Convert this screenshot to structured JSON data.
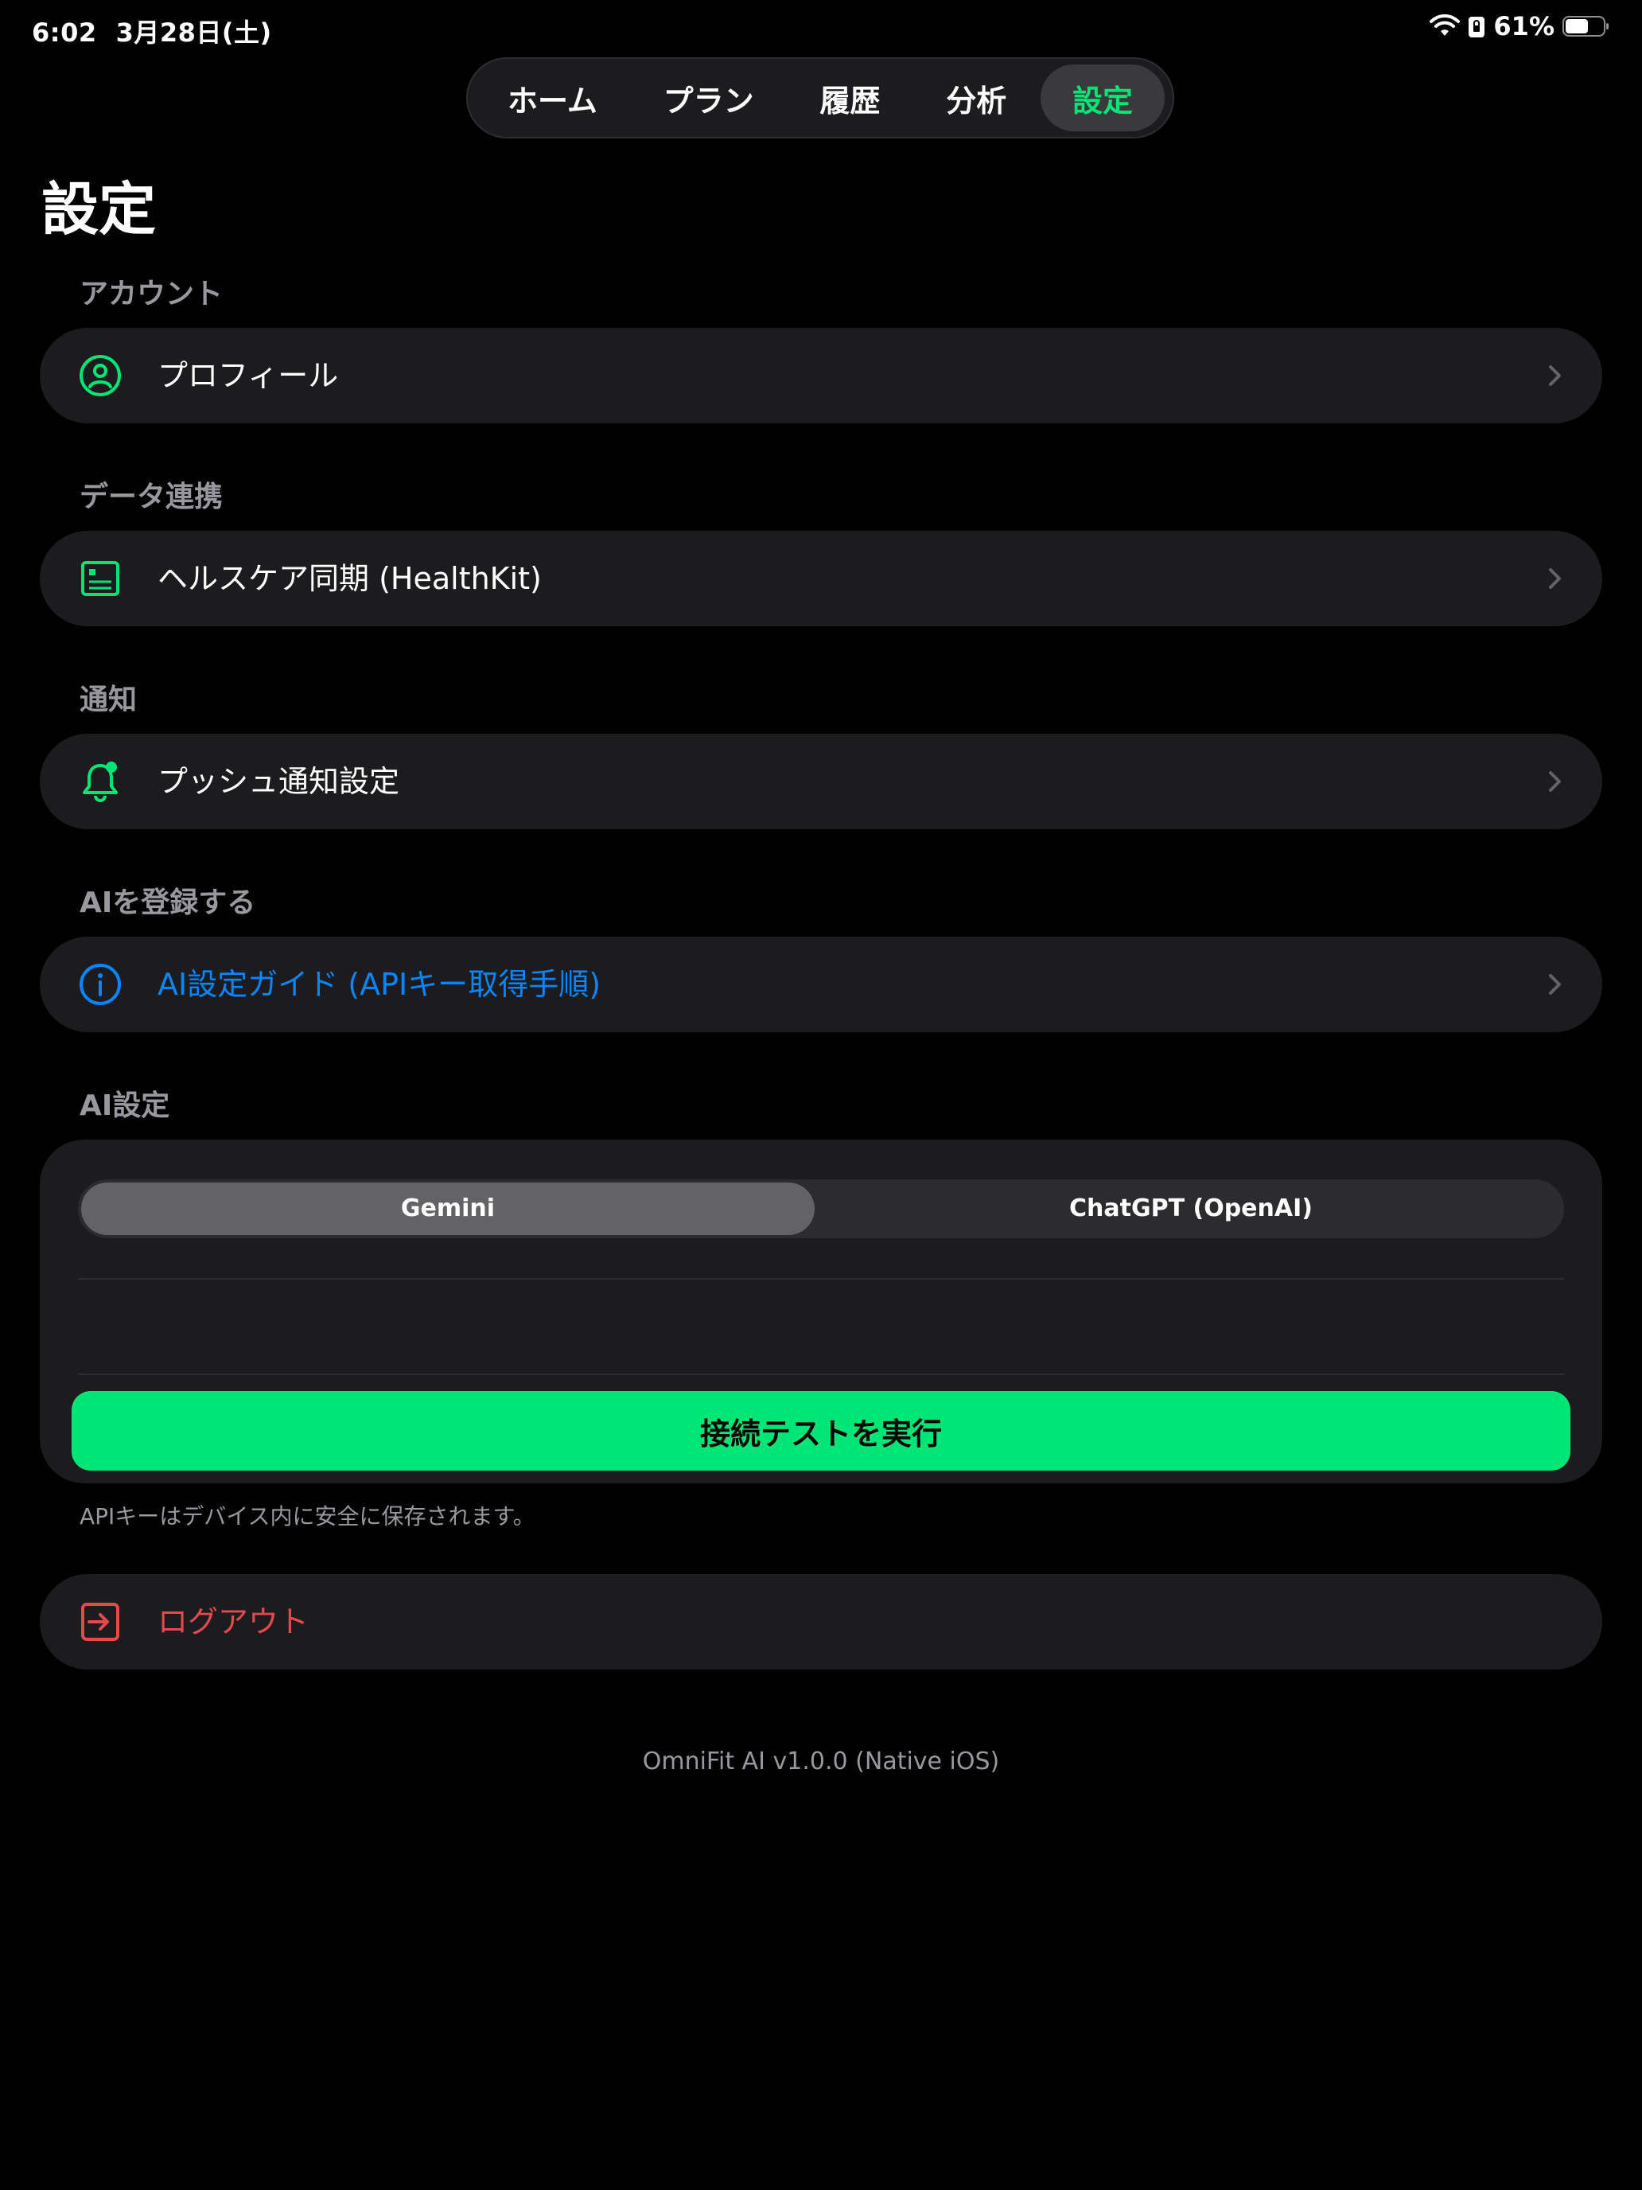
{
  "status_bar": {
    "time": "6:02",
    "date": "3月28日(土)",
    "battery_percent": "61%",
    "battery_level": 0.61
  },
  "nav": {
    "tabs": [
      {
        "label": "ホーム",
        "active": false
      },
      {
        "label": "プラン",
        "active": false
      },
      {
        "label": "履歴",
        "active": false
      },
      {
        "label": "分析",
        "active": false
      },
      {
        "label": "設定",
        "active": true
      }
    ]
  },
  "page": {
    "title": "設定"
  },
  "sections": {
    "account": {
      "label": "アカウント",
      "item": {
        "label": "プロフィール",
        "icon": "person-circle-icon"
      }
    },
    "data_sync": {
      "label": "データ連携",
      "item": {
        "label": "ヘルスケア同期 (HealthKit)",
        "icon": "health-data-icon"
      }
    },
    "notifications": {
      "label": "通知",
      "item": {
        "label": "プッシュ通知設定",
        "icon": "bell-badge-icon"
      }
    },
    "ai_register": {
      "label": "AIを登録する",
      "item": {
        "label": "AI設定ガイド (APIキー取得手順)",
        "icon": "info-circle-icon"
      }
    },
    "ai_settings": {
      "label": "AI設定",
      "providers": [
        "Gemini",
        "ChatGPT (OpenAI)"
      ],
      "selected_provider": "Gemini",
      "api_key_value": "",
      "test_button_label": "接続テストを実行",
      "footnote": "APIキーはデバイス内に安全に保存されます。"
    }
  },
  "logout": {
    "label": "ログアウト",
    "icon": "logout-icon"
  },
  "footer": {
    "version": "OmniFit AI v1.0.0 (Native iOS)"
  },
  "colors": {
    "accent_green": "#00e676",
    "link_blue": "#0a84ff",
    "danger_red": "#e5484d",
    "card_bg": "#1c1c1e",
    "secondary_text": "#98989f"
  }
}
